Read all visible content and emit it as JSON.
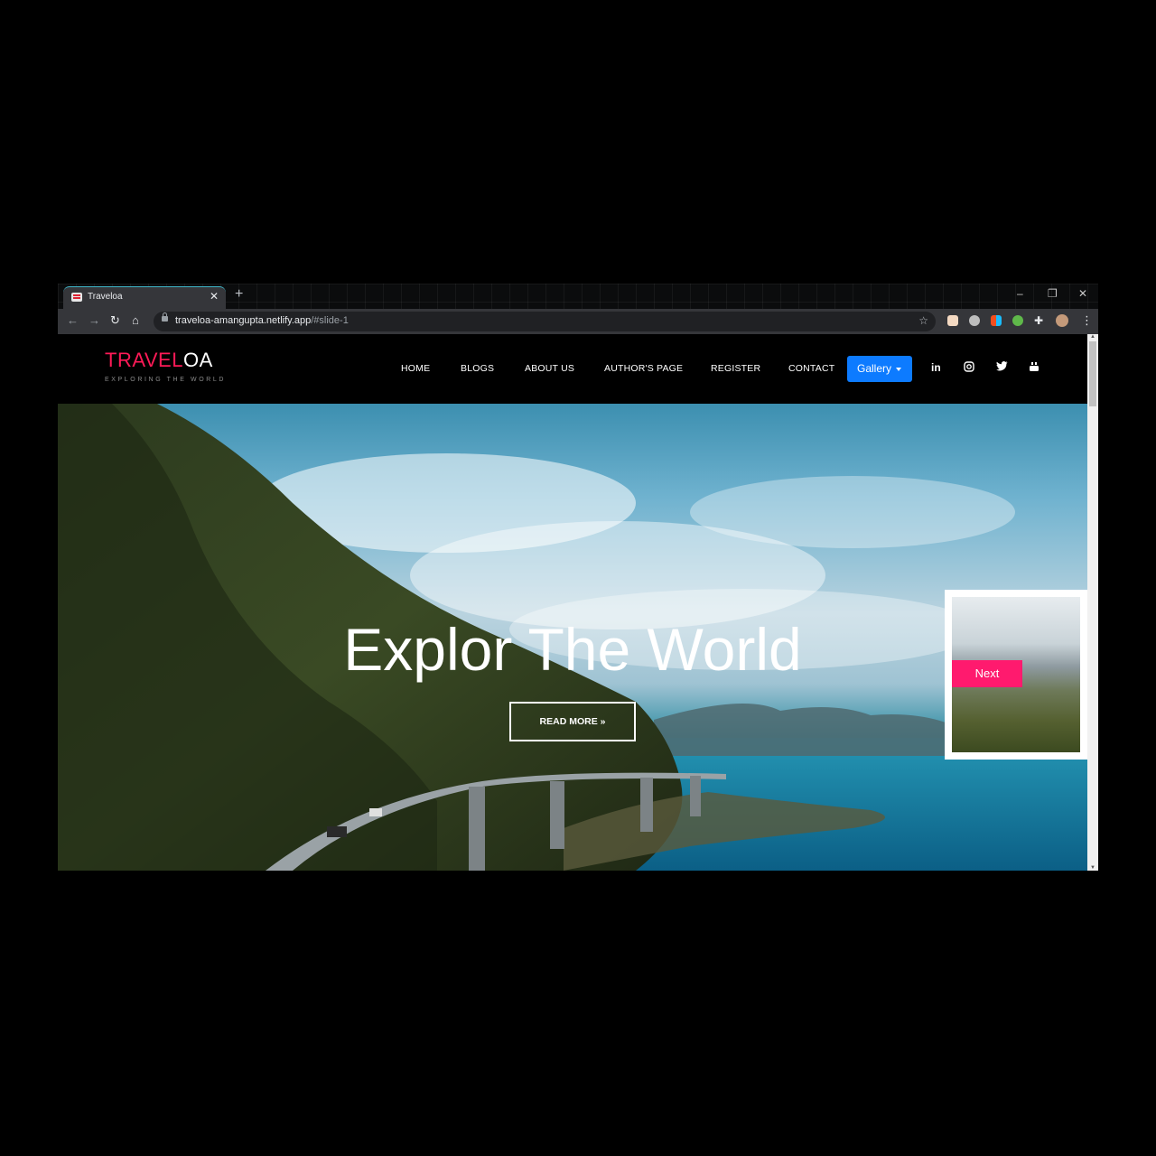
{
  "browser": {
    "tab_title": "Traveloa",
    "url_host": "traveloa-amangupta.netlify.app",
    "url_hash": "/#slide-1"
  },
  "site": {
    "logo_pink": "TRAVEL",
    "logo_white": "OA",
    "tagline": "EXPLORING THE WORLD",
    "nav": [
      "HOME",
      "BLOGS",
      "ABOUT US",
      "AUTHOR'S PAGE",
      "REGISTER",
      "CONTACT"
    ],
    "gallery_label": "Gallery",
    "social_icons": [
      "linkedin-icon",
      "instagram-icon",
      "twitter-icon",
      "youtube-icon"
    ]
  },
  "hero": {
    "title": "Explor The World",
    "read_more": "READ MORE",
    "next_label": "Next"
  },
  "colors": {
    "brand_pink": "#ff1a57",
    "gallery_blue": "#0d7bff",
    "next_pink": "#ff1a6e"
  }
}
